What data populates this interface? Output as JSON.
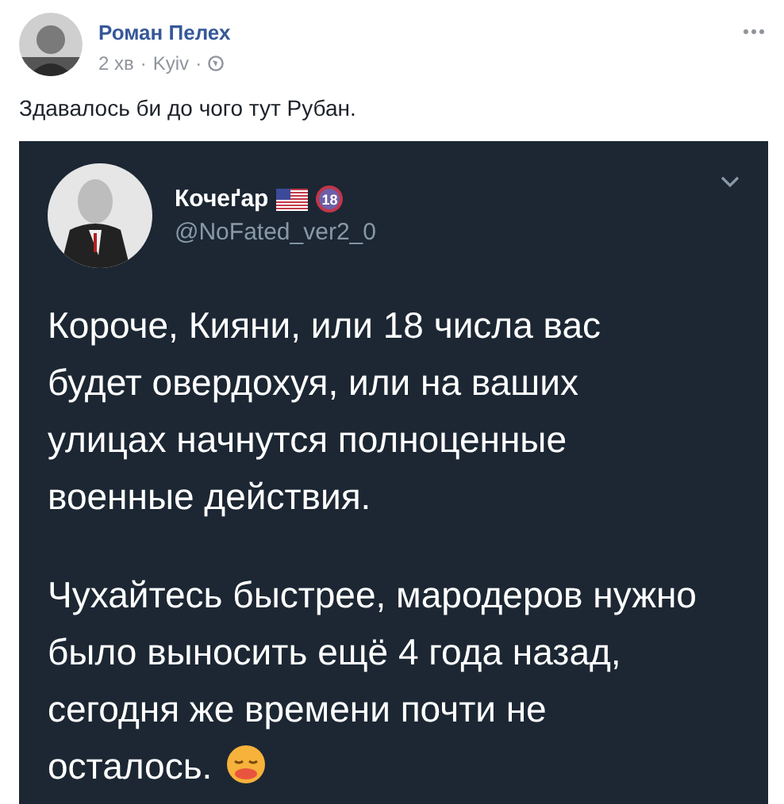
{
  "post": {
    "author": "Роман Пелех",
    "time": "2 хв",
    "location": "Kyiv",
    "separator": "·",
    "text": "Здавалось би до чого тут Рубан."
  },
  "tweet": {
    "name": "Кочеґар",
    "badge": "18",
    "handle": "@NoFated_ver2_0",
    "paragraphs": [
      "Короче, Кияни, или 18 числа вас будет овердохуя, или на ваших улицах начнутся полноценные военные действия.",
      "Чухайтесь быстрее, мародеров нужно было выносить ещё 4 года назад, сегодня же времени почти не осталось."
    ]
  }
}
